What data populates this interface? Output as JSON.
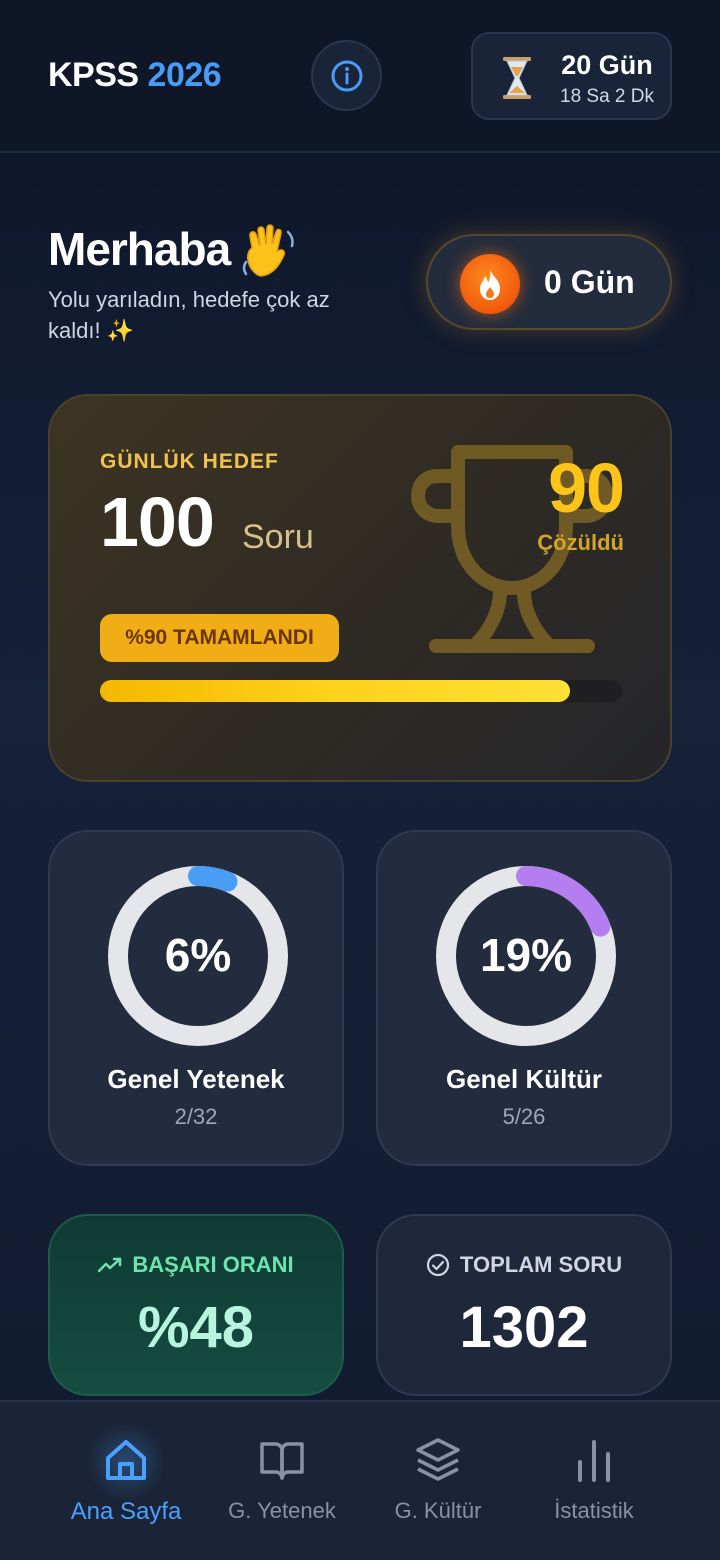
{
  "header": {
    "title": "KPSS",
    "year": "2026",
    "countdown": {
      "days": "20 Gün",
      "hours": "18 Sa 2 Dk"
    }
  },
  "greeting": {
    "title": "Merhaba",
    "subtitle": "Yolu yarıladın, hedefe çok az kaldı! ✨"
  },
  "streak": {
    "label": "0 Gün"
  },
  "daily_goal": {
    "label": "GÜNLÜK HEDEF",
    "target": "100",
    "unit": "Soru",
    "solved": "90",
    "solved_label": "Çözüldü",
    "badge": "%90 TAMAMLANDI",
    "progress_percent": 90
  },
  "subjects": [
    {
      "percent_label": "6%",
      "progress_percent": 6,
      "title": "Genel Yetenek",
      "sub": "2/32",
      "color": "#4a9df5"
    },
    {
      "percent_label": "19%",
      "progress_percent": 19,
      "title": "Genel Kültür",
      "sub": "5/26",
      "color": "#b47ef0"
    }
  ],
  "stats": {
    "success": {
      "label": "BAŞARI ORANI",
      "value": "%48"
    },
    "total": {
      "label": "TOPLAM SORU",
      "value": "1302"
    }
  },
  "nav": {
    "items": [
      {
        "label": "Ana Sayfa",
        "icon": "home-icon"
      },
      {
        "label": "G. Yetenek",
        "icon": "book-icon"
      },
      {
        "label": "G. Kültür",
        "icon": "layers-icon"
      },
      {
        "label": "İstatistik",
        "icon": "bar-chart-icon"
      }
    ]
  },
  "colors": {
    "accent": "#4a9bf5",
    "gold": "#fcc419",
    "success": "#6ee2b0"
  }
}
